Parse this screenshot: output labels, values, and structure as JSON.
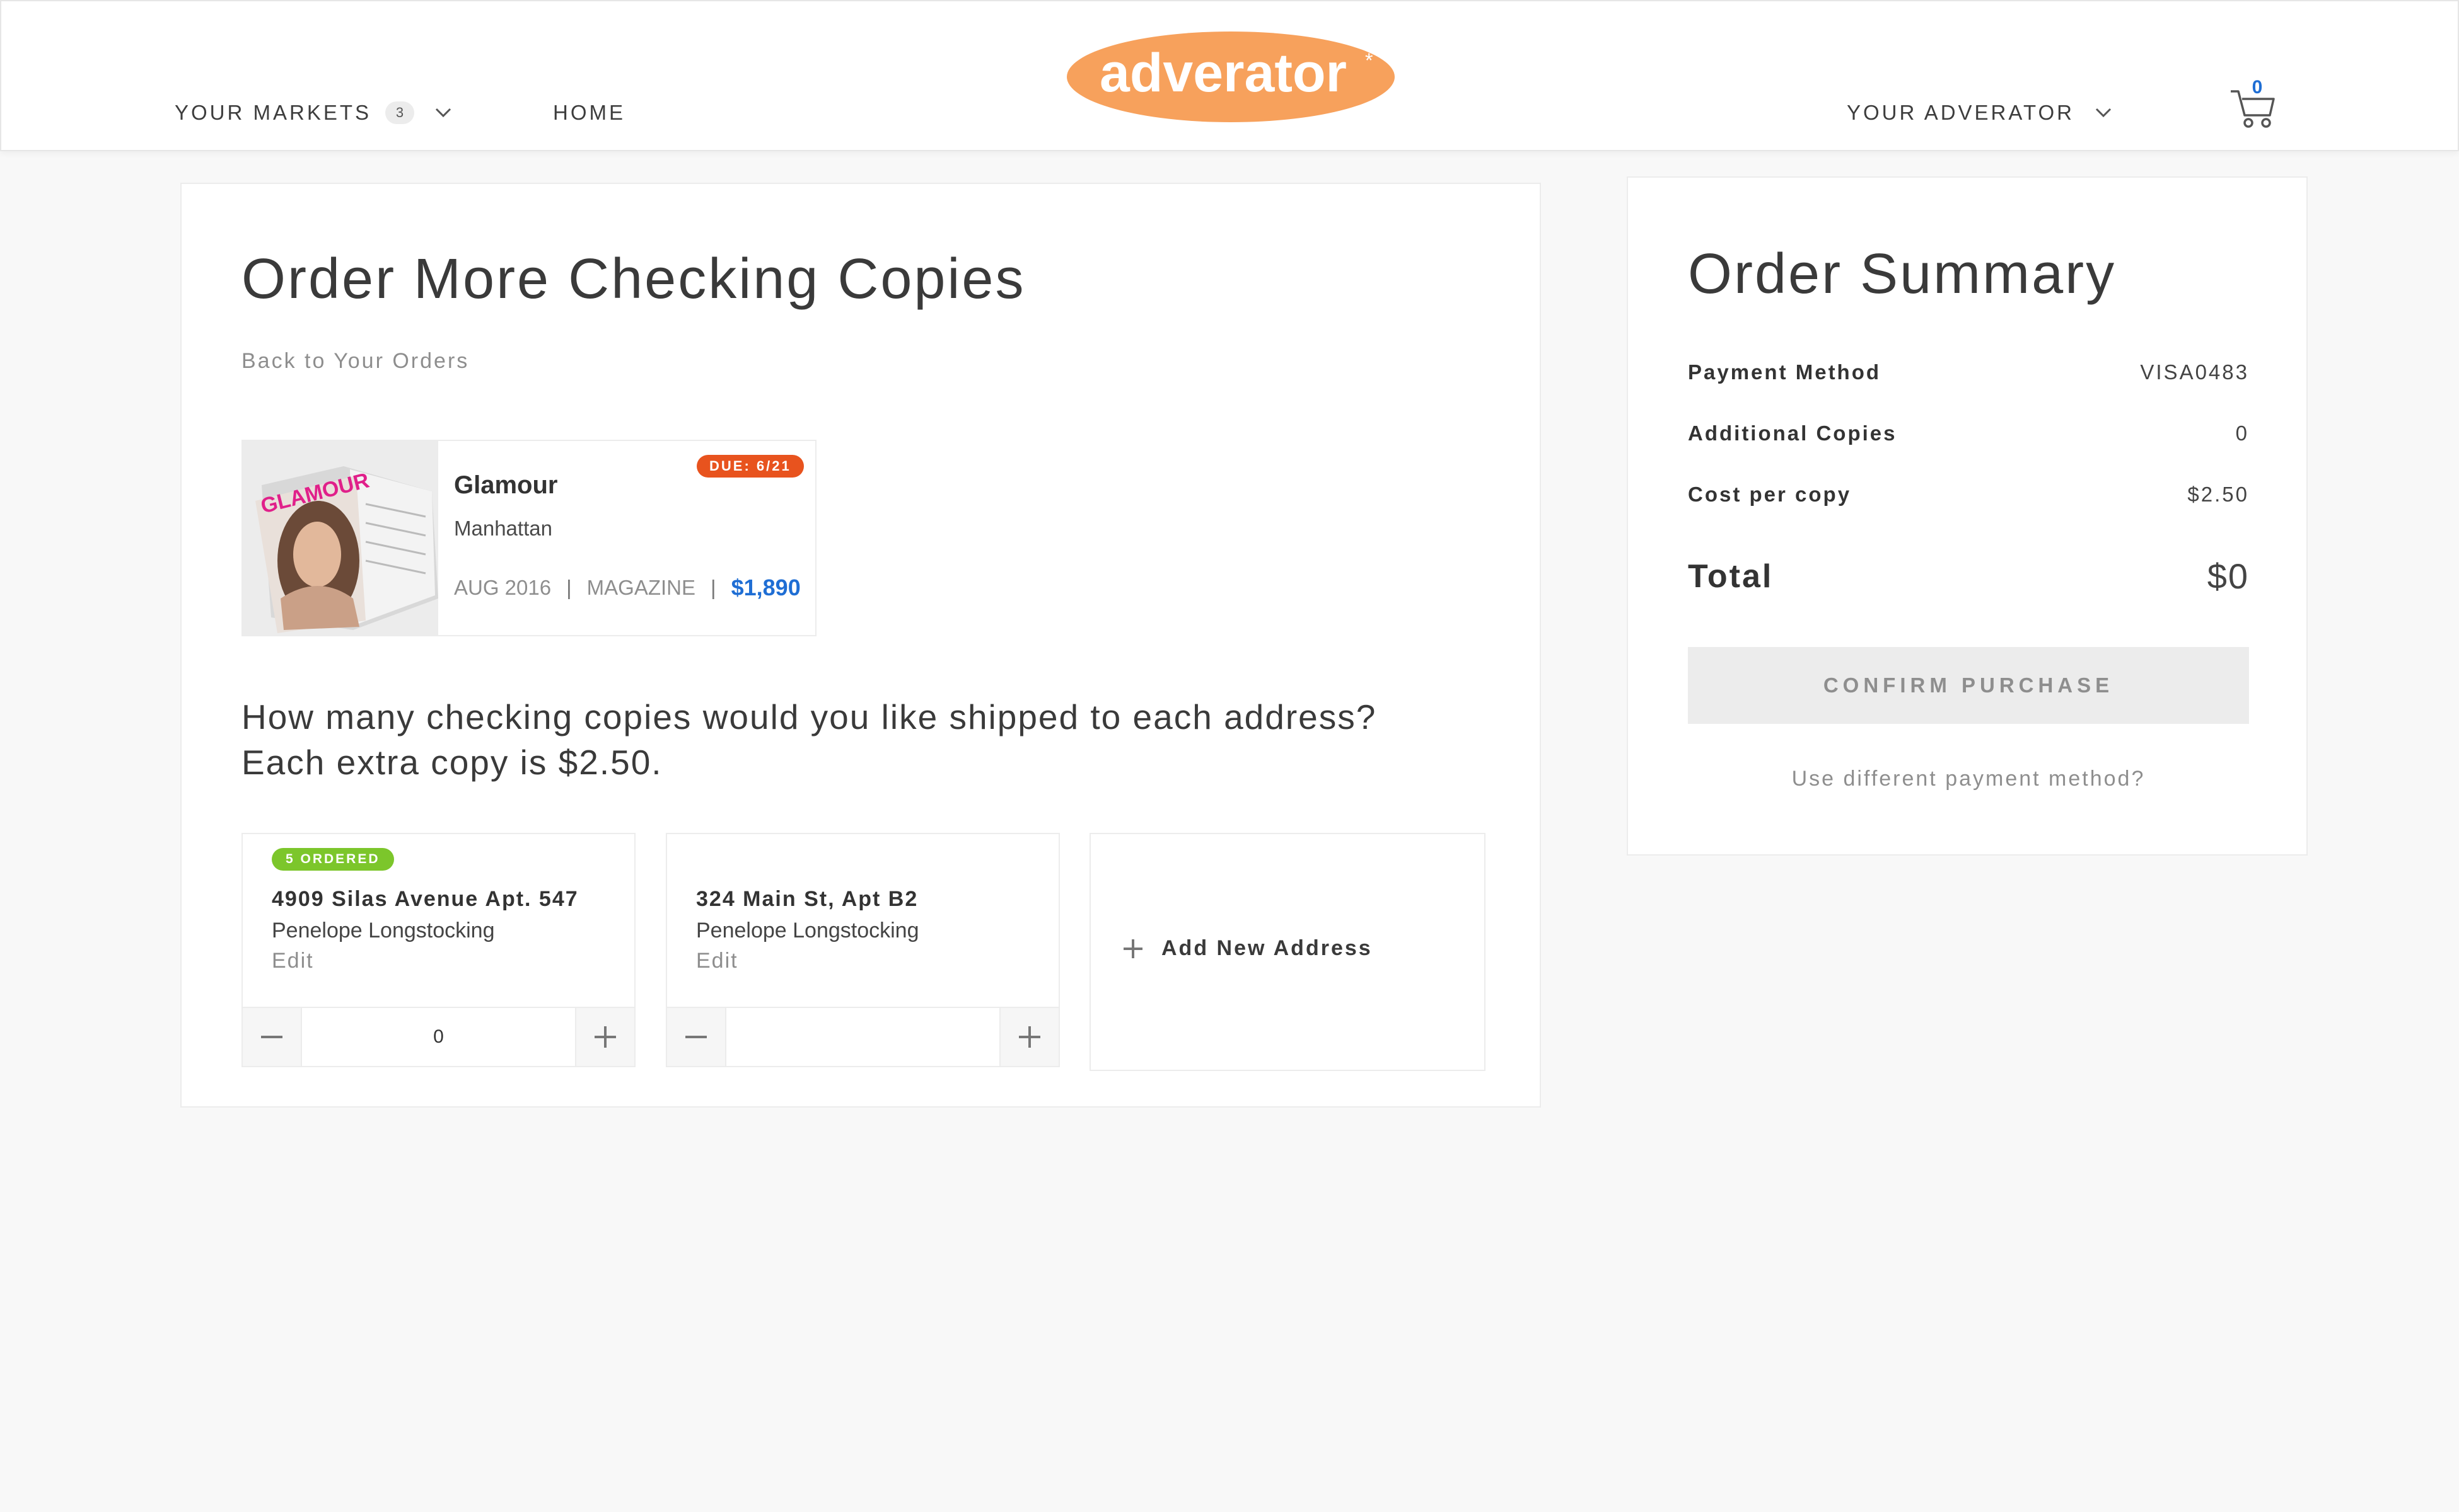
{
  "header": {
    "markets_label": "YOUR MARKETS",
    "markets_count": "3",
    "home_label": "HOME",
    "logo_text": "adverator",
    "account_label": "YOUR ADVERATOR",
    "cart_count": "0"
  },
  "order": {
    "title": "Order More Checking Copies",
    "back_link": "Back to Your Orders",
    "publication": {
      "name": "Glamour",
      "market": "Manhattan",
      "issue": "AUG 2016",
      "type": "MAGAZINE",
      "price": "$1,890",
      "due_badge": "DUE: 6/21",
      "thumb_text": "GLAMOUR"
    },
    "question": "How many checking copies would you like shipped to each address? Each extra copy is $2.50.",
    "addresses": [
      {
        "badge": "5 ORDERED",
        "line": "4909 Silas Avenue Apt. 547",
        "name": "Penelope Longstocking",
        "edit_label": "Edit",
        "quantity": "0"
      },
      {
        "badge": "",
        "line": "324 Main St, Apt B2",
        "name": "Penelope Longstocking",
        "edit_label": "Edit",
        "quantity": ""
      }
    ],
    "add_address_label": "Add New Address"
  },
  "summary": {
    "title": "Order Summary",
    "payment_method_label": "Payment Method",
    "payment_method_value": "VISA0483",
    "additional_copies_label": "Additional Copies",
    "additional_copies_value": "0",
    "cost_per_copy_label": "Cost per copy",
    "cost_per_copy_value": "$2.50",
    "total_label": "Total",
    "total_value": "$0",
    "confirm_label": "CONFIRM PURCHASE",
    "different_payment_label": "Use different payment method?"
  },
  "colors": {
    "brand_orange": "#f7a15c",
    "due_badge": "#e8531e",
    "ordered_badge": "#7cc62b",
    "price_blue": "#1f6ed4"
  }
}
